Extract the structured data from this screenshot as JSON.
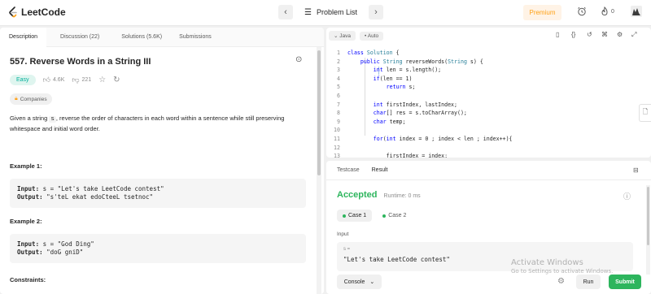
{
  "topbar": {
    "logo": "LeetCode",
    "problem_list": "Problem List",
    "premium": "Premium",
    "fire_count": "0"
  },
  "left_tabs": [
    "Description",
    "Discussion (22)",
    "Solutions (5.6K)",
    "Submissions"
  ],
  "problem": {
    "title": "557. Reverse Words in a String III",
    "difficulty": "Easy",
    "likes": "4.6K",
    "dislikes": "221",
    "companies": "Companies",
    "desc_before": "Given a string ",
    "desc_code": "s",
    "desc_after": ", reverse the order of characters in each word within a sentence while still preserving whitespace and initial word order.",
    "examples": [
      {
        "heading": "Example 1:",
        "input_label": "Input:",
        "input": "s = \"Let's take LeetCode contest\"",
        "output_label": "Output:",
        "output": "\"s'teL ekat edoCteeL tsetnoc\""
      },
      {
        "heading": "Example 2:",
        "input_label": "Input:",
        "input": "s = \"God Ding\"",
        "output_label": "Output:",
        "output": "\"doG gniD\""
      }
    ],
    "constraints_heading": "Constraints:"
  },
  "editor": {
    "language": "Java",
    "autocomplete": "Auto",
    "code_lines": [
      {
        "n": "1",
        "text": "class Solution {"
      },
      {
        "n": "2",
        "text": "    public String reverseWords(String s) {"
      },
      {
        "n": "3",
        "text": "        int len = s.length();"
      },
      {
        "n": "4",
        "text": "        if(len == 1)"
      },
      {
        "n": "5",
        "text": "            return s;"
      },
      {
        "n": "6",
        "text": ""
      },
      {
        "n": "7",
        "text": "        int firstIndex, lastIndex;"
      },
      {
        "n": "8",
        "text": "        char[] res = s.toCharArray();"
      },
      {
        "n": "9",
        "text": "        char temp;"
      },
      {
        "n": "10",
        "text": ""
      },
      {
        "n": "11",
        "text": "        for(int index = 0 ; index < len ; index++){"
      },
      {
        "n": "12",
        "text": ""
      },
      {
        "n": "13",
        "text": "            firstIndex = index;"
      }
    ]
  },
  "result": {
    "tabs": [
      "Testcase",
      "Result"
    ],
    "status": "Accepted",
    "runtime": "Runtime: 0 ms",
    "cases": [
      "Case 1",
      "Case 2"
    ],
    "input_label": "Input",
    "var_name": "s =",
    "input_value": "\"Let's take LeetCode contest\""
  },
  "footer": {
    "console": "Console",
    "run": "Run",
    "submit": "Submit"
  },
  "watermark": {
    "line1": "Activate Windows",
    "line2": "Go to Settings to activate Windows."
  },
  "colors": {
    "accent_green": "#2db55d",
    "premium_orange": "#ffa116",
    "easy_teal": "#00af9b"
  }
}
